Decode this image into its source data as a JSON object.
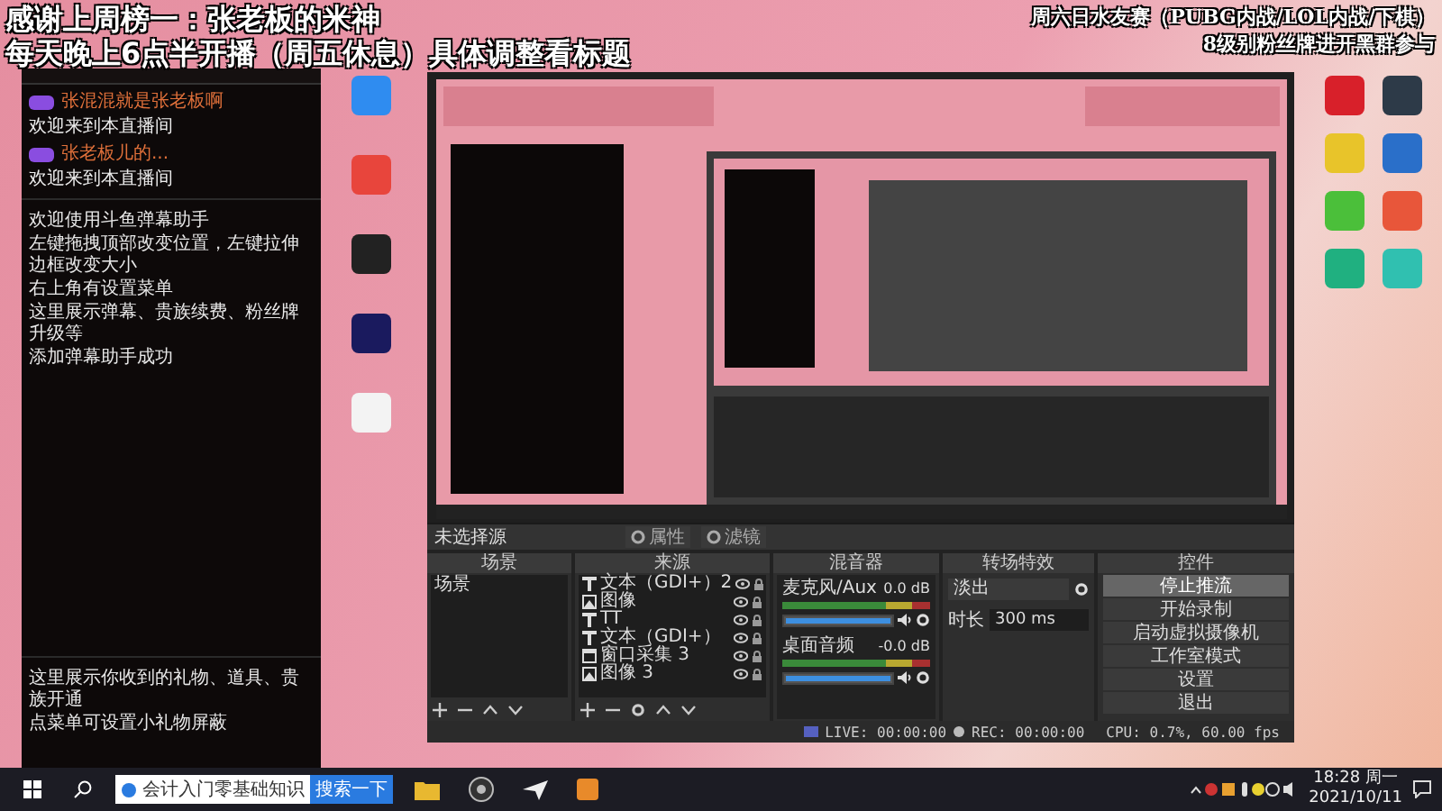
{
  "overlay": {
    "left_lines": [
      "感谢上周榜一：张老板的米神",
      "每天晚上6点半开播（周五休息）具体调整看标题"
    ],
    "right_lines": [
      "周六日水友赛（PUBG内战/LOL内战/下棋）",
      "8级别粉丝牌进开黑群参与"
    ]
  },
  "desktop_icons": {
    "middle": [
      {
        "color": "#2f8cf0"
      },
      {
        "color": "#e8453c"
      },
      {
        "color": "#222222"
      },
      {
        "color": "#1a1a5e"
      },
      {
        "color": "#f3f3f3"
      }
    ],
    "right": [
      {
        "color": "#d8202a"
      },
      {
        "color": "#2d3a48"
      },
      {
        "color": "#e8c42a"
      },
      {
        "color": "#2a6fc9"
      },
      {
        "color": "#4bbf3a"
      },
      {
        "color": "#e8563a"
      },
      {
        "color": "#20b080"
      },
      {
        "color": "#30c0b0"
      }
    ]
  },
  "danmu_panel": {
    "messages": [
      {
        "user": "张混混就是张老板啊",
        "text": "欢迎来到本直播间"
      },
      {
        "user": "张老板儿的...",
        "text": "欢迎来到本直播间"
      }
    ],
    "info_lines": [
      "欢迎使用斗鱼弹幕助手",
      "左键拖拽顶部改变位置，左键拉伸边框改变大小",
      "右上角有设置菜单",
      "这里展示弹幕、贵族续费、粉丝牌升级等",
      "添加弹幕助手成功"
    ],
    "gift_lines": [
      "这里展示你收到的礼物、道具、贵族开通",
      "点菜单可设置小礼物屏蔽"
    ]
  },
  "obs": {
    "toolbar": {
      "label": "未选择源",
      "buttons": [
        "属性",
        "滤镜"
      ]
    },
    "scenes": {
      "title": "场景",
      "items": [
        {
          "name": "场景",
          "selected": false
        }
      ]
    },
    "sources": {
      "title": "来源",
      "items": [
        {
          "kind": "text",
          "name": "文本（GDI+）2"
        },
        {
          "kind": "image",
          "name": "图像"
        },
        {
          "kind": "text",
          "name": "TT"
        },
        {
          "kind": "text",
          "name": "文本（GDI+）"
        },
        {
          "kind": "window",
          "name": "窗口采集 3"
        },
        {
          "kind": "image",
          "name": "图像 3"
        }
      ]
    },
    "mixer": {
      "title": "混音器",
      "channels": [
        {
          "name": "麦克风/Aux",
          "reading": "0.0 dB",
          "level": 1
        },
        {
          "name": "桌面音频",
          "reading": "-0.0 dB",
          "level": 1
        }
      ]
    },
    "transitions": {
      "title": "转场特效",
      "effect": "淡出",
      "duration_label": "时长",
      "duration": "300 ms"
    },
    "controls": {
      "title": "控件",
      "buttons": [
        {
          "label": "停止推流",
          "active": true
        },
        {
          "label": "开始录制",
          "active": false
        },
        {
          "label": "启动虚拟摄像机",
          "active": false
        },
        {
          "label": "工作室模式",
          "active": false
        },
        {
          "label": "设置",
          "active": false
        },
        {
          "label": "退出",
          "active": false
        }
      ]
    },
    "status": {
      "live": "LIVE: 00:00:00",
      "rec": "REC: 00:00:00",
      "cpu": "CPU: 0.7%, 60.00 fps"
    }
  },
  "taskbar": {
    "search": "会计入门零基础知识",
    "search_button": "搜索一下",
    "time": "18:28 周一",
    "date": "2021/10/11"
  }
}
